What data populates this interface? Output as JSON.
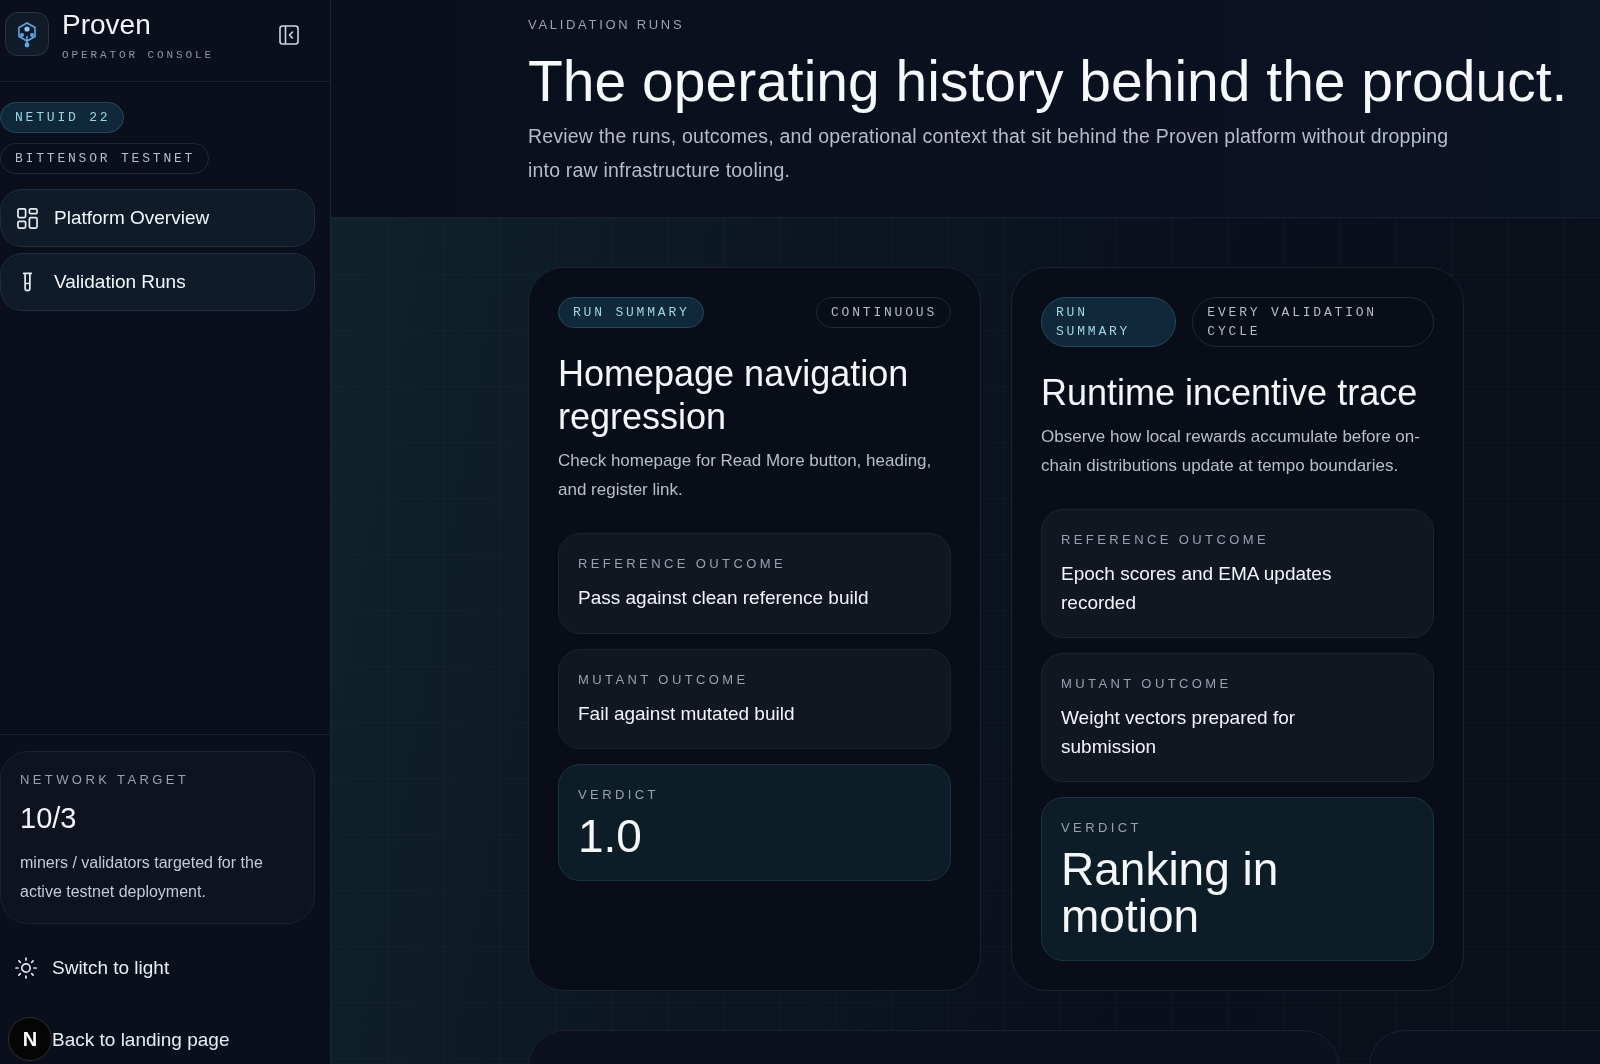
{
  "sidebar": {
    "brand": {
      "name": "Proven",
      "subtitle": "OPERATOR CONSOLE"
    },
    "badges": [
      {
        "label": "NETUID 22",
        "kind": "accent"
      },
      {
        "label": "BITTENSOR TESTNET",
        "kind": "outline"
      }
    ],
    "nav_items": [
      {
        "label": "Platform Overview"
      },
      {
        "label": "Validation Runs"
      }
    ],
    "network_target": {
      "label": "NETWORK TARGET",
      "value": "10/3",
      "description": "miners / validators targeted for the active testnet deployment."
    },
    "theme_toggle": {
      "label": "Switch to light"
    },
    "back_link": {
      "label": "Back to landing page"
    }
  },
  "header": {
    "eyebrow": "VALIDATION RUNS",
    "title": "The operating history behind the product.",
    "description": "Review the runs, outcomes, and operational context that sit behind the Proven platform without dropping into raw infrastructure tooling."
  },
  "run_cards": [
    {
      "tag": "RUN SUMMARY",
      "cadence": "CONTINUOUS",
      "title": "Homepage navigation regression",
      "description": "Check homepage for Read More button, heading, and register link.",
      "outcomes": [
        {
          "kind": "outcome",
          "label": "REFERENCE OUTCOME",
          "value": "Pass against clean reference build"
        },
        {
          "kind": "outcome",
          "label": "MUTANT OUTCOME",
          "value": "Fail against mutated build"
        },
        {
          "kind": "verdict",
          "label": "VERDICT",
          "value": "1.0"
        }
      ]
    },
    {
      "tag": "RUN SUMMARY",
      "cadence": "EVERY VALIDATION CYCLE",
      "title": "Runtime incentive trace",
      "description": "Observe how local rewards accumulate before on-chain distributions update at tempo boundaries.",
      "outcomes": [
        {
          "kind": "outcome",
          "label": "REFERENCE OUTCOME",
          "value": "Epoch scores and EMA updates recorded"
        },
        {
          "kind": "outcome",
          "label": "MUTANT OUTCOME",
          "value": "Weight vectors prepared for submission"
        },
        {
          "kind": "verdict",
          "label": "VERDICT",
          "value": "Ranking in motion"
        }
      ]
    }
  ],
  "dev_indicator": {
    "label": "N"
  }
}
